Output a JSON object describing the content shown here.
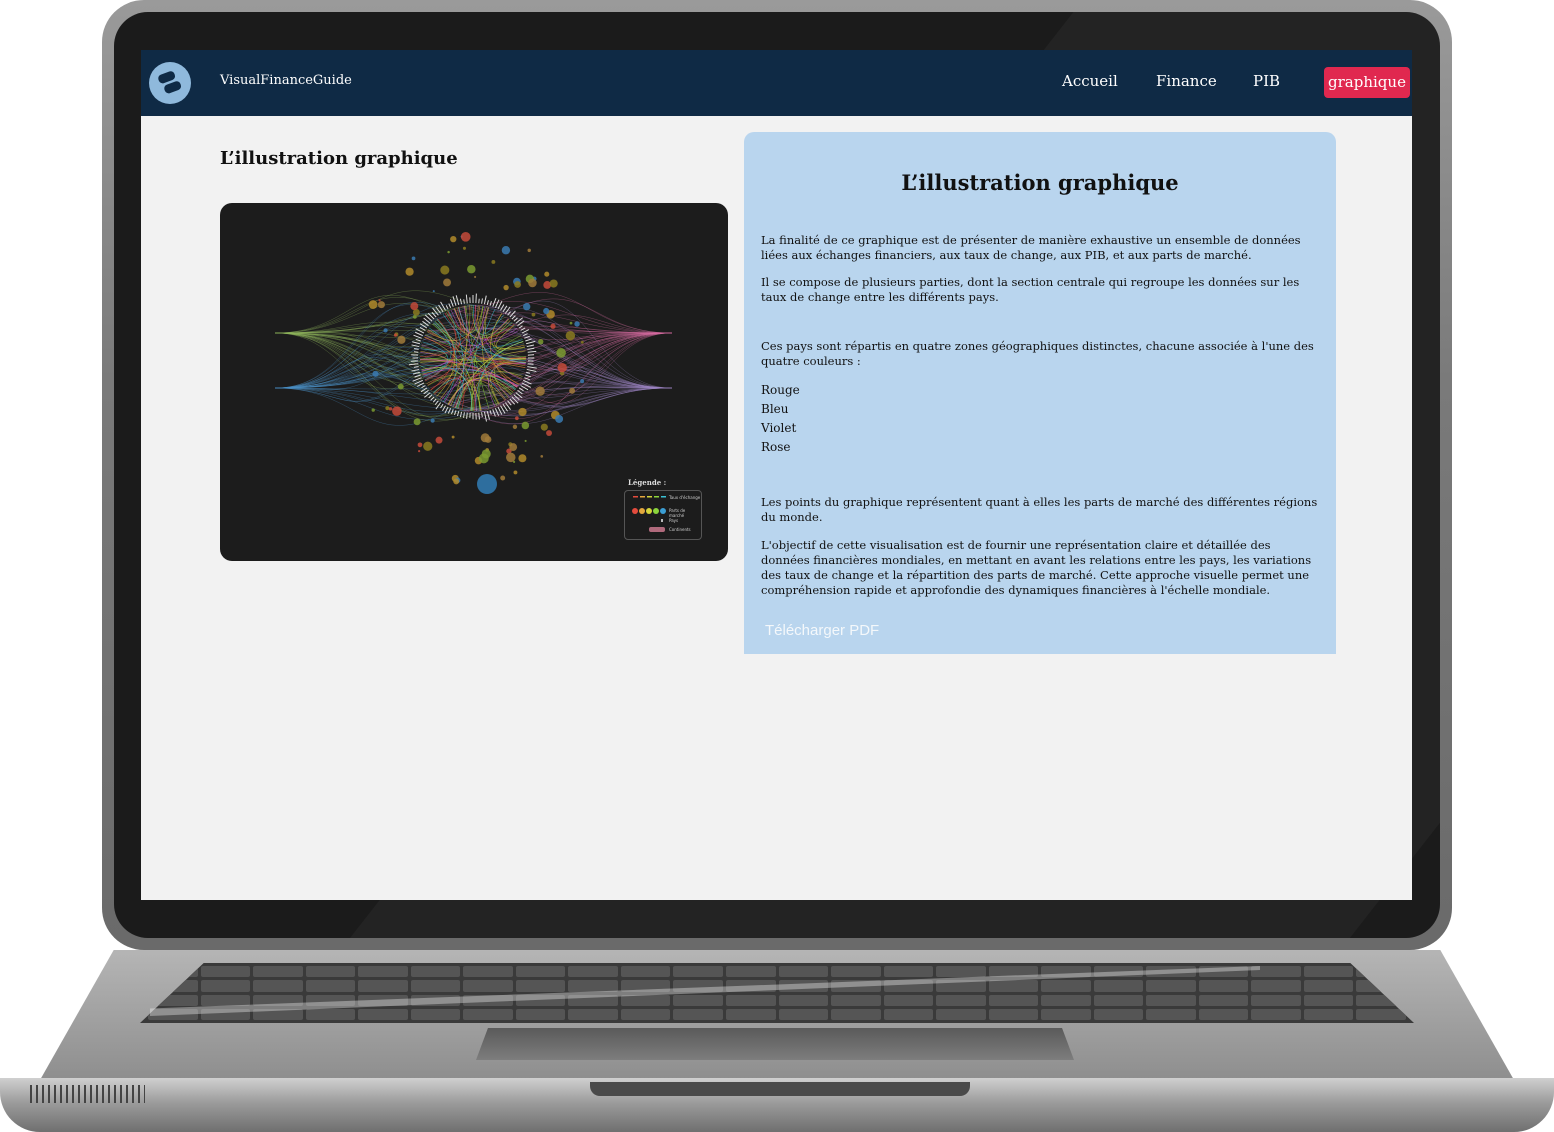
{
  "navbar": {
    "brand": "VisualFinanceGuide",
    "links": [
      "Accueil",
      "Finance",
      "PIB"
    ],
    "active_link": "graphique"
  },
  "left": {
    "title": "L’illustration graphique"
  },
  "visualization": {
    "legend_title": "Légende :",
    "legend_items": [
      "Taux d'échange",
      "Parts de marché",
      "Pays",
      "Continents"
    ]
  },
  "panel": {
    "title": "L’illustration graphique",
    "p1": "La finalité de ce graphique est de présenter de manière exhaustive un ensemble de données liées aux échanges financiers, aux taux de change, aux PIB, et aux parts de marché.",
    "p2": "Il se compose de plusieurs parties, dont la section centrale qui regroupe les données sur les taux de change entre les différents pays.",
    "p3": "Ces pays sont répartis en quatre zones géographiques distinctes, chacune associée à l'une des quatre couleurs :",
    "colors": [
      "Rouge",
      "Bleu",
      "Violet",
      "Rose"
    ],
    "p4": "Les points du graphique représentent quant à elles les parts de marché des différentes régions du monde.",
    "p5": "L'objectif  de cette visualisation est de fournir une représentation claire et détaillée des données financières mondiales, en mettant en avant les relations entre les pays, les variations des taux de change et la répartition des parts de marché. Cette approche visuelle permet une compréhension rapide et approfondie des dynamiques financières à l'échelle mondiale.",
    "pdf_button": "Télécharger PDF"
  },
  "colors": {
    "navbar_bg": "#0f2a45",
    "active_bg": "#e0284f",
    "panel_bg": "#b9d5ee",
    "viz_bg": "#1c1c1c"
  }
}
